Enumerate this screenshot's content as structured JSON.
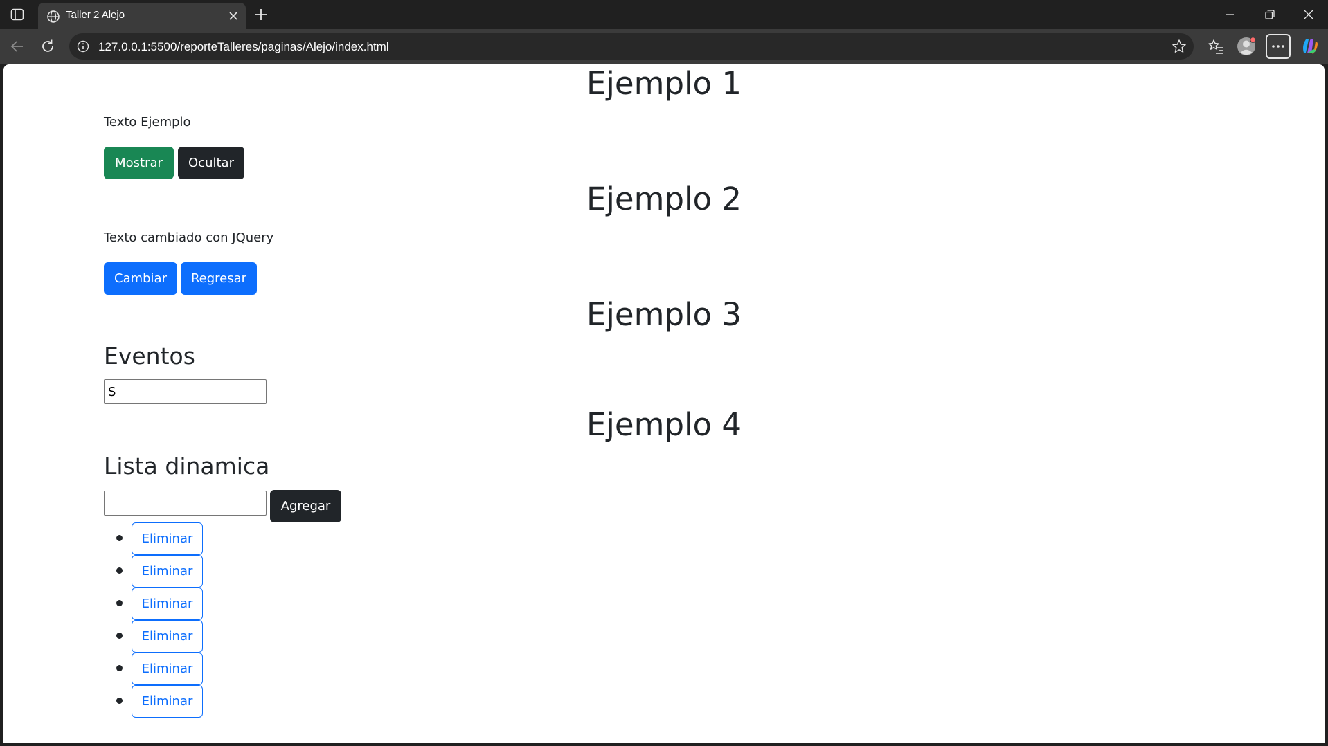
{
  "browser": {
    "tab_title": "Taller 2 Alejo",
    "url": "127.0.0.1:5500/reporteTalleres/paginas/Alejo/index.html"
  },
  "icons": {
    "sidebar": "sidebar-toggle-icon",
    "tab": "globe-icon",
    "close": "close-icon",
    "new_tab": "plus-icon",
    "back": "back-arrow-icon",
    "reload": "reload-icon",
    "info": "info-icon",
    "favorite": "star-icon",
    "favorites": "favorites-icon",
    "profile": "profile-icon",
    "more": "more-icon",
    "copilot": "copilot-icon"
  },
  "colors": {
    "success": "#198754",
    "dark": "#212529",
    "primary": "#0d6efd"
  },
  "page": {
    "ejemplo1": {
      "heading": "Ejemplo 1",
      "text": "Texto Ejemplo",
      "show_label": "Mostrar",
      "hide_label": "Ocultar"
    },
    "ejemplo2": {
      "heading": "Ejemplo 2",
      "text": "Texto cambiado con JQuery",
      "change_label": "Cambiar",
      "revert_label": "Regresar"
    },
    "ejemplo3": {
      "heading": "Ejemplo 3",
      "subheading": "Eventos",
      "input_value": "S"
    },
    "ejemplo4": {
      "heading": "Ejemplo 4",
      "subheading": "Lista dinamica",
      "input_value": "",
      "add_label": "Agregar",
      "items": [
        {
          "label": "Eliminar"
        },
        {
          "label": "Eliminar"
        },
        {
          "label": "Eliminar"
        },
        {
          "label": "Eliminar"
        },
        {
          "label": "Eliminar"
        },
        {
          "label": "Eliminar"
        }
      ]
    }
  }
}
